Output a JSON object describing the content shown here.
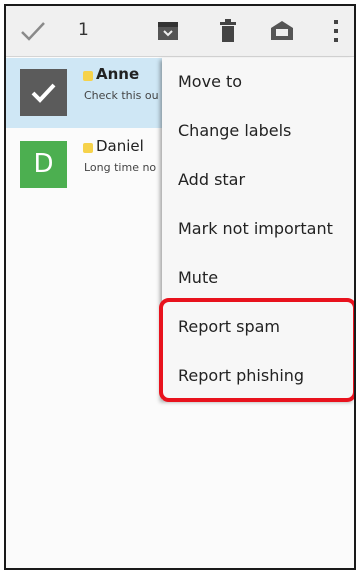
{
  "topbar": {
    "selected_count": "1",
    "icons": [
      "done-check-icon",
      "archive-icon",
      "trash-icon",
      "labels-icon",
      "overflow-menu-icon"
    ]
  },
  "emails": [
    {
      "sender": "Anne",
      "snippet": "Check this ou",
      "selected": true
    },
    {
      "sender": "Daniel",
      "snippet": "Long time no",
      "avatar_letter": "D"
    }
  ],
  "menu": {
    "items": [
      "Move to",
      "Change labels",
      "Add star",
      "Mark not important",
      "Mute",
      "Report spam",
      "Report phishing"
    ]
  },
  "colors": {
    "selected_row": "#cfe7f5",
    "avatar_green": "#4caf50",
    "highlight": "#e8121d",
    "star": "#f6d24a"
  }
}
